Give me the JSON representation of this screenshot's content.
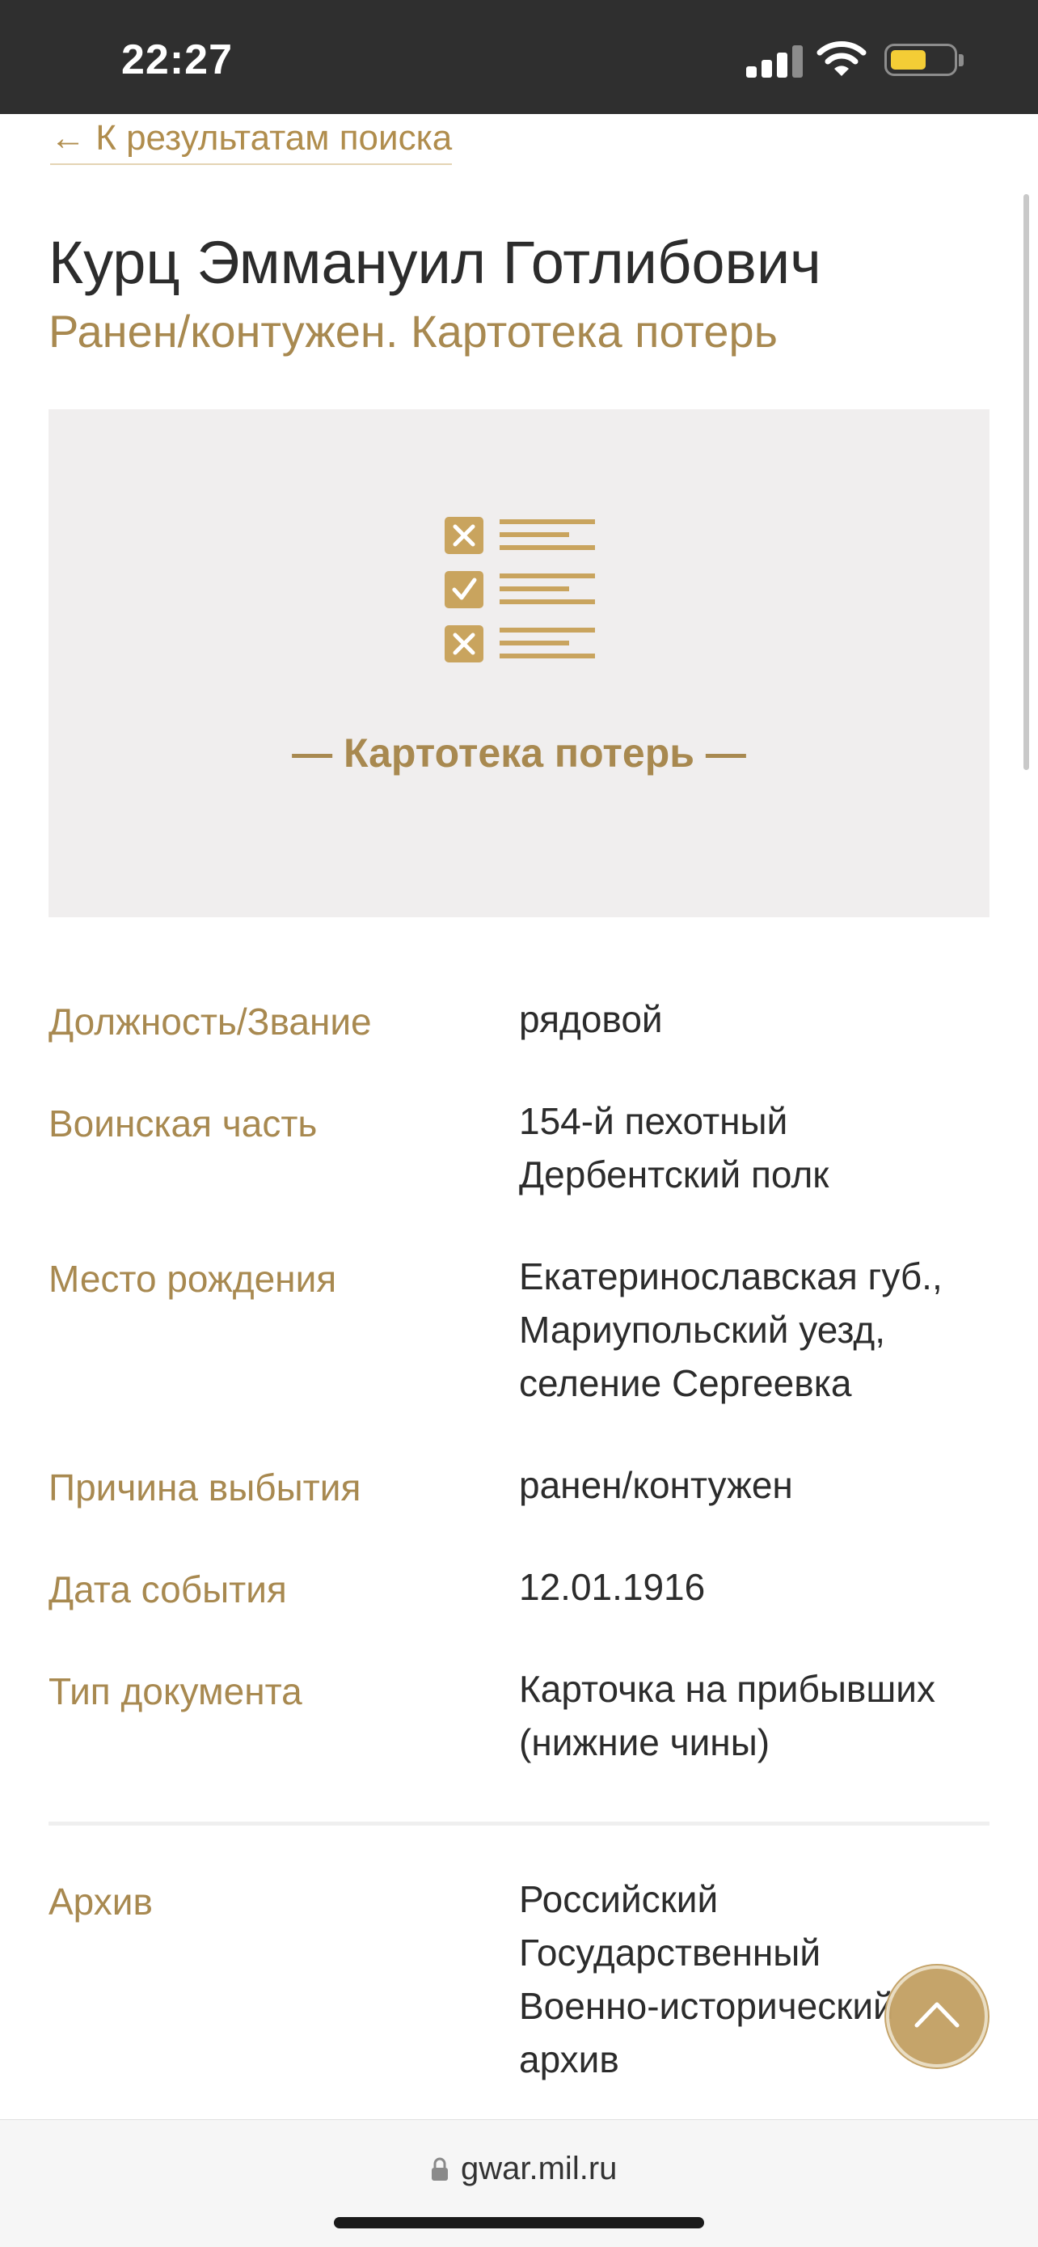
{
  "status_bar": {
    "time": "22:27",
    "battery_level": 0.55
  },
  "nav": {
    "back_label": "← К результатам поиска"
  },
  "header": {
    "name": "Курц Эммануил Готлибович",
    "subtitle": "Ранен/контужен. Картотека потерь"
  },
  "card": {
    "caption": "— Картотека потерь —",
    "icon": "checklist-icon"
  },
  "details": [
    {
      "label": "Должность/Звание",
      "value": "рядовой"
    },
    {
      "label": "Воинская часть",
      "value": "154-й пехотный Дербентский полк"
    },
    {
      "label": "Место рождения",
      "value": "Екатеринославская губ., Мариупольский уезд, селение Сергеевка"
    },
    {
      "label": "Причина выбытия",
      "value": "ранен/контужен"
    },
    {
      "label": "Дата события",
      "value": "12.01.1916"
    },
    {
      "label": "Тип документа",
      "value": "Карточка на прибывших (нижние чины)"
    },
    {
      "label": "Архив",
      "value": "Российский Государственный Военно-исторический архив"
    }
  ],
  "browser": {
    "url": "gwar.mil.ru"
  },
  "colors": {
    "accent": "#a88950",
    "card_bg": "#f0eeee",
    "icon": "#c9a45e"
  }
}
